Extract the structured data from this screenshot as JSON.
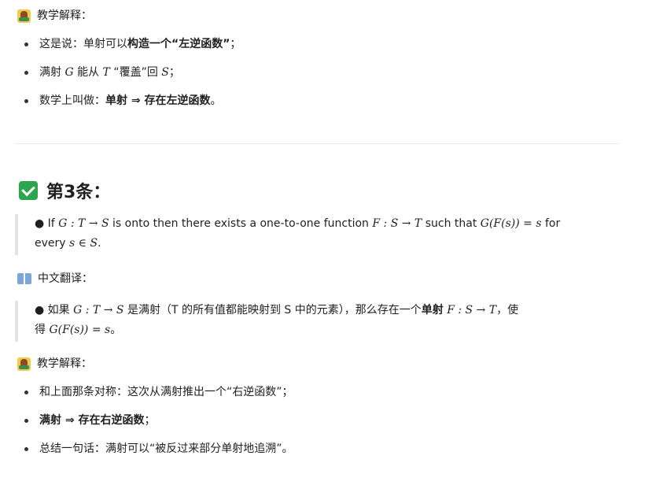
{
  "teach_label": "教学解释：",
  "translate_label": "中文翻译：",
  "block1": {
    "items": [
      {
        "a": "这是说：单射可以",
        "b": "构造一个“左逆函数”",
        "c": "；"
      },
      {
        "a": "满射 ",
        "g": "G",
        "b": " 能从 ",
        "t": "T",
        "c": " “覆盖”回 ",
        "s": "S",
        "d": "；"
      },
      {
        "a": "数学上叫做：",
        "b": "单射 ⇒ 存在左逆函数",
        "c": "。"
      }
    ]
  },
  "heading": "第3条：",
  "quote_en": {
    "p1": "● If ",
    "m1": "G : T → S",
    "p2": " is onto then there exists a one-to-one function ",
    "m2": "F : S → T",
    "p3": " such that ",
    "m3": "G(F(s)) = s",
    "p4": " for",
    "p5": "every ",
    "m4": "s ∈ S",
    "p6": "."
  },
  "quote_zh": {
    "p1": "● 如果 ",
    "m1": "G : T → S",
    "p2": " 是满射（T 的所有值都能映射到 S 中的元素），那么存在一个",
    "b1": "单射",
    "p3": " ",
    "m2": "F : S → T",
    "p4": "，使",
    "p5": "得 ",
    "m3": "G(F(s)) = s",
    "p6": "。"
  },
  "block2": {
    "items": [
      {
        "a": "和上面那条对称：这次从满射推出一个“右逆函数”；"
      },
      {
        "b": "满射 ⇒ 存在右逆函数",
        "c": "；"
      },
      {
        "a": "总结一句话：满射可以“被反过来部分单射地追溯”。"
      }
    ]
  }
}
